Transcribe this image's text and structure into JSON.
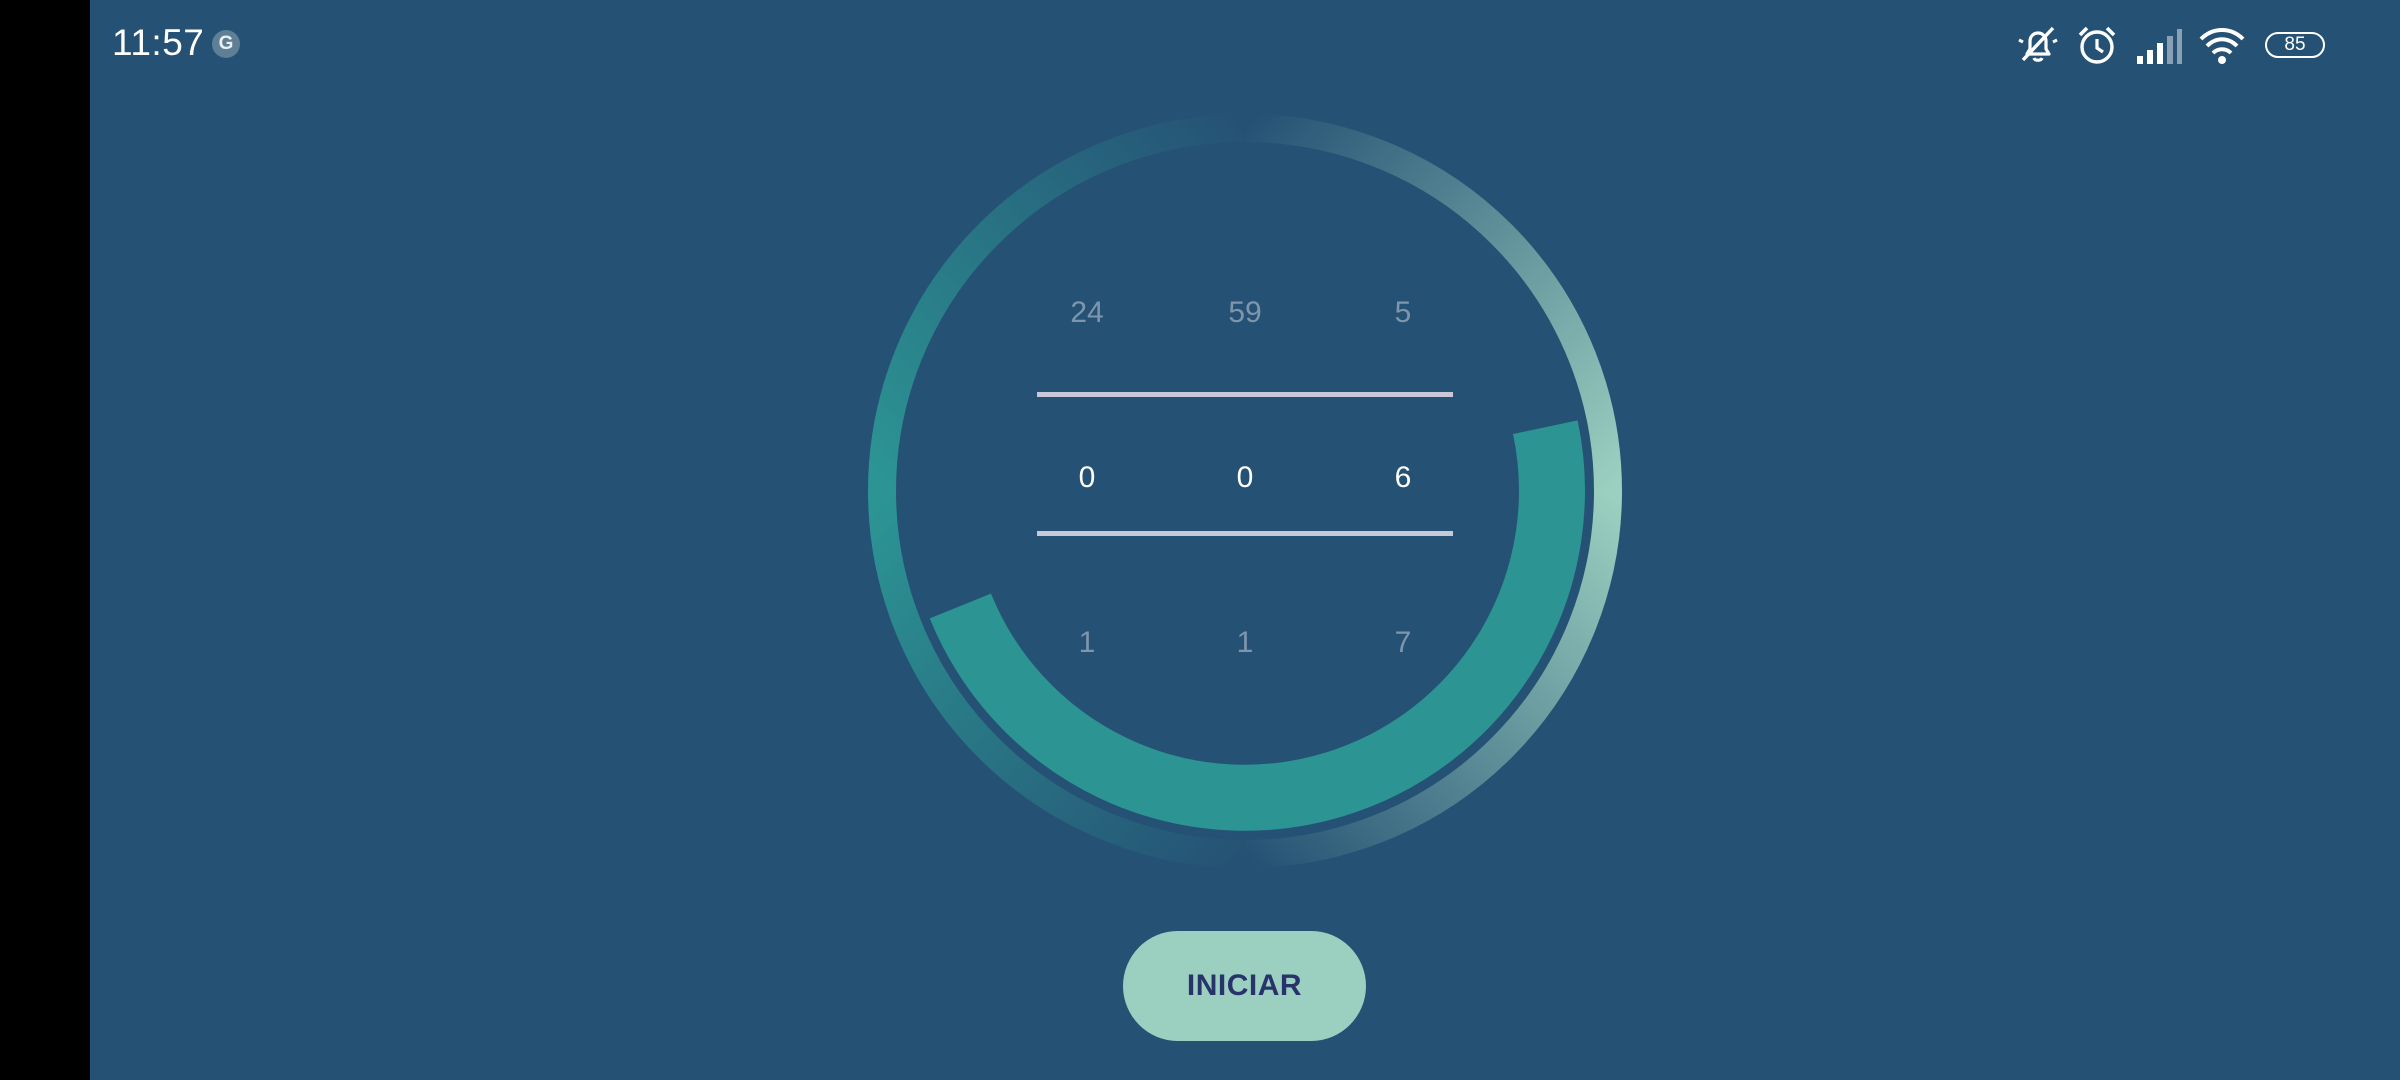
{
  "status_bar": {
    "time": "11:57",
    "notification_icon": "google-icon",
    "notification_letter": "G",
    "icons": [
      "mute-icon",
      "alarm-icon",
      "signal-icon",
      "wifi-icon"
    ],
    "battery": "85"
  },
  "timer": {
    "progress_ring_color": "#2c9594",
    "outer_ring_colors": [
      "#2c9594",
      "#9bd0c0"
    ],
    "background_color": "#255274",
    "picker": {
      "hours": {
        "above": "24",
        "selected": "0",
        "below": "1"
      },
      "minutes": {
        "above": "59",
        "selected": "0",
        "below": "1"
      },
      "seconds": {
        "above": "5",
        "selected": "6",
        "below": "7"
      }
    }
  },
  "actions": {
    "start_label": "INICIAR",
    "start_color": "#9bd0c0"
  }
}
